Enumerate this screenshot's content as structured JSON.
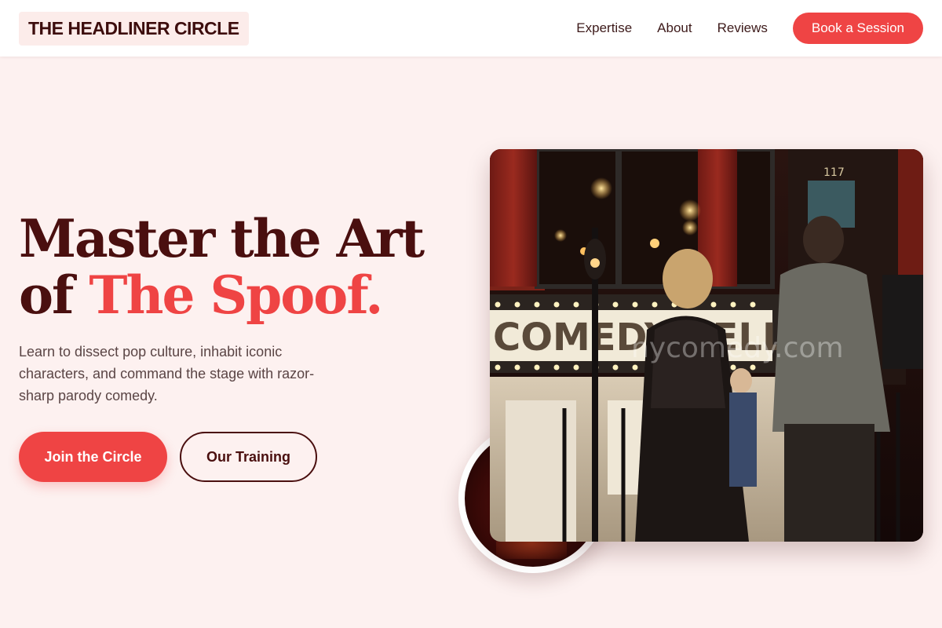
{
  "header": {
    "logo": "THE HEADLINER CIRCLE",
    "nav": [
      "Expertise",
      "About",
      "Reviews"
    ],
    "cta": "Book a Session"
  },
  "hero": {
    "headline_line1": "Master the Art",
    "headline_of": "of ",
    "headline_accent": "The Spoof.",
    "subtext": "Learn to dissect pop culture, inhabit iconic characters, and command the stage with razor-sharp parody comedy.",
    "primary_button": "Join the Circle",
    "secondary_button": "Our Training"
  },
  "photo": {
    "marquee_text": "COMEDY CELLAR",
    "door_number": "117",
    "watermark": "nycomedy.com"
  },
  "colors": {
    "accent": "#ef4444",
    "brand_dark": "#4a0f0f",
    "background": "#fdf1f0"
  }
}
